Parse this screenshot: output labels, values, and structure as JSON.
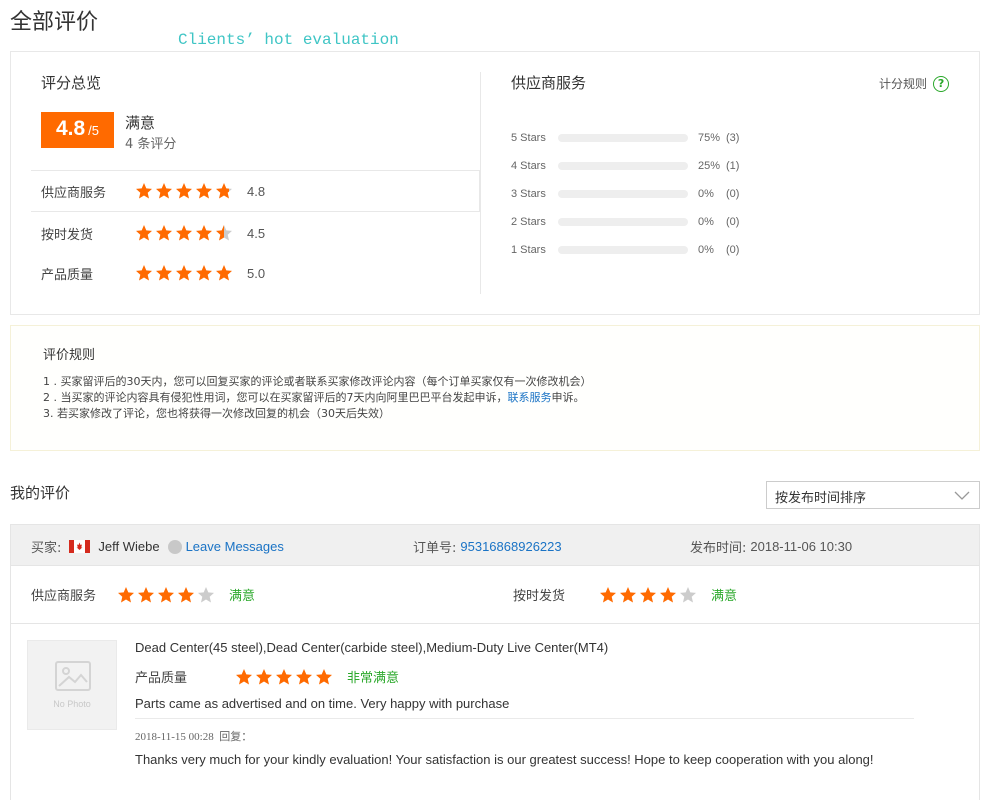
{
  "page": {
    "title": "全部评价",
    "annotation": "Clients’ hot evaluation"
  },
  "summary": {
    "title": "评分总览",
    "score": "4.8",
    "score_max": "/5",
    "level": "满意",
    "review_count": "4 条评分",
    "ratings": [
      {
        "label": "供应商服务",
        "stars": 4.8,
        "value": "4.8"
      },
      {
        "label": "按时发货",
        "stars": 4.5,
        "value": "4.5"
      },
      {
        "label": "产品质量",
        "stars": 5.0,
        "value": "5.0"
      }
    ]
  },
  "supplier": {
    "title": "供应商服务",
    "rule_link": "计分规则",
    "rule_icon": "help-circle-icon",
    "distribution": [
      {
        "label": "5 Stars",
        "fraction": 0.75,
        "percent": "75%",
        "count": "(3)"
      },
      {
        "label": "4 Stars",
        "fraction": 0.25,
        "percent": "25%",
        "count": "(1)"
      },
      {
        "label": "3 Stars",
        "fraction": 0,
        "percent": "0%",
        "count": "(0)"
      },
      {
        "label": "2 Stars",
        "fraction": 0,
        "percent": "0%",
        "count": "(0)"
      },
      {
        "label": "1 Stars",
        "fraction": 0,
        "percent": "0%",
        "count": "(0)"
      }
    ]
  },
  "rules": {
    "title": "评价规则",
    "line1": "1 . 买家留评后的30天内，您可以回复买家的评论或者联系买家修改评论内容（每个订单买家仅有一次修改机会）",
    "line2_pre": "2 . 当买家的评论内容具有侵犯性用词，您可以在买家留评后的7天内向阿里巴巴平台发起申诉，",
    "line2_link": "联系服务",
    "line2_post": "申诉。",
    "line3": "3. 若买家修改了评论，您也将获得一次修改回复的机会（30天后失效）"
  },
  "my_reviews": {
    "title": "我的评价",
    "sort_value": "按发布时间排序"
  },
  "review": {
    "buyer_label": "买家:",
    "buyer_flag": "canada-flag-icon",
    "buyer_name": "Jeff Wiebe",
    "leave_messages": "Leave Messages",
    "order_label": "订单号:",
    "order_no": "95316868926223",
    "time_label": "发布时间:",
    "time_value": "2018-11-06 10:30",
    "supplier_label": "供应商服务",
    "supplier_stars": 4,
    "supplier_level": "满意",
    "delivery_label": "按时发货",
    "delivery_stars": 4,
    "delivery_level": "满意",
    "no_photo": "No Photo",
    "product_name": "Dead Center(45 steel),Dead Center(carbide steel),Medium-Duty Live Center(MT4)",
    "quality_label": "产品质量",
    "quality_stars": 5,
    "quality_level": "非常满意",
    "feedback": "Parts came as advertised and on time. Very happy with purchase",
    "reply_time": "2018-11-15 00:28",
    "reply_label": "回复：",
    "reply_text": "Thanks very much for your kindly evaluation! Your satisfaction is our greatest success! Hope to keep cooperation with you along!"
  },
  "colors": {
    "accent": "#ff6a00",
    "star_empty": "#cccccc",
    "green": "#2aa82a",
    "link": "#1a73c5"
  }
}
